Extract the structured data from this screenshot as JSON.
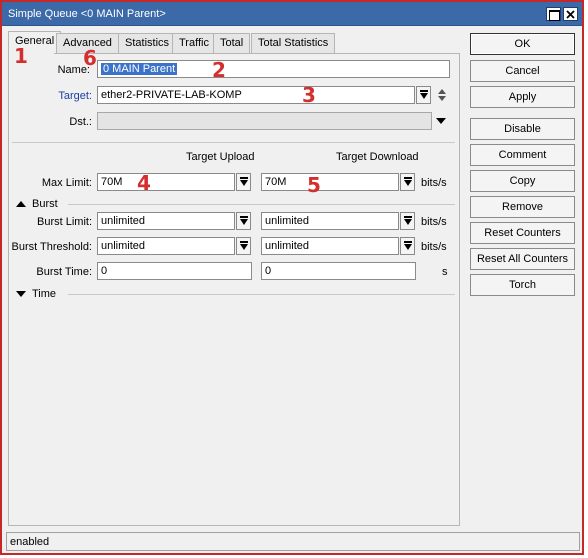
{
  "window": {
    "title": "Simple Queue <0 MAIN Parent>"
  },
  "tabs": [
    {
      "label": "General",
      "active": true
    },
    {
      "label": "Advanced"
    },
    {
      "label": "Statistics"
    },
    {
      "label": "Traffic"
    },
    {
      "label": "Total"
    },
    {
      "label": "Total Statistics"
    }
  ],
  "form": {
    "name_label": "Name:",
    "name_value": "0 MAIN Parent",
    "target_label": "Target:",
    "target_value": "ether2-PRIVATE-LAB-KOMP",
    "dst_label": "Dst.:",
    "dst_value": "",
    "col_upload": "Target Upload",
    "col_download": "Target Download",
    "max_limit_label": "Max Limit:",
    "max_limit_upload": "70M",
    "max_limit_download": "70M",
    "unit_bits": "bits/s",
    "burst_section": "Burst",
    "burst_limit_label": "Burst Limit:",
    "burst_limit_upload": "unlimited",
    "burst_limit_download": "unlimited",
    "burst_threshold_label": "Burst Threshold:",
    "burst_threshold_upload": "unlimited",
    "burst_threshold_download": "unlimited",
    "burst_time_label": "Burst Time:",
    "burst_time_upload": "0",
    "burst_time_download": "0",
    "unit_s": "s",
    "time_section": "Time"
  },
  "buttons": {
    "ok": "OK",
    "cancel": "Cancel",
    "apply": "Apply",
    "disable": "Disable",
    "comment": "Comment",
    "copy": "Copy",
    "remove": "Remove",
    "reset_counters": "Reset Counters",
    "reset_all_counters": "Reset All Counters",
    "torch": "Torch"
  },
  "status": {
    "text": "enabled"
  },
  "annotations": {
    "a1": "1",
    "a2": "2",
    "a3": "3",
    "a4": "4",
    "a5": "5",
    "a6": "6"
  },
  "colors": {
    "titlebar": "#3c69a8",
    "frame_border": "#c62828",
    "annotation": "#d32f2f",
    "target_label": "#1a3ea3",
    "selection": "#3a73c9"
  }
}
